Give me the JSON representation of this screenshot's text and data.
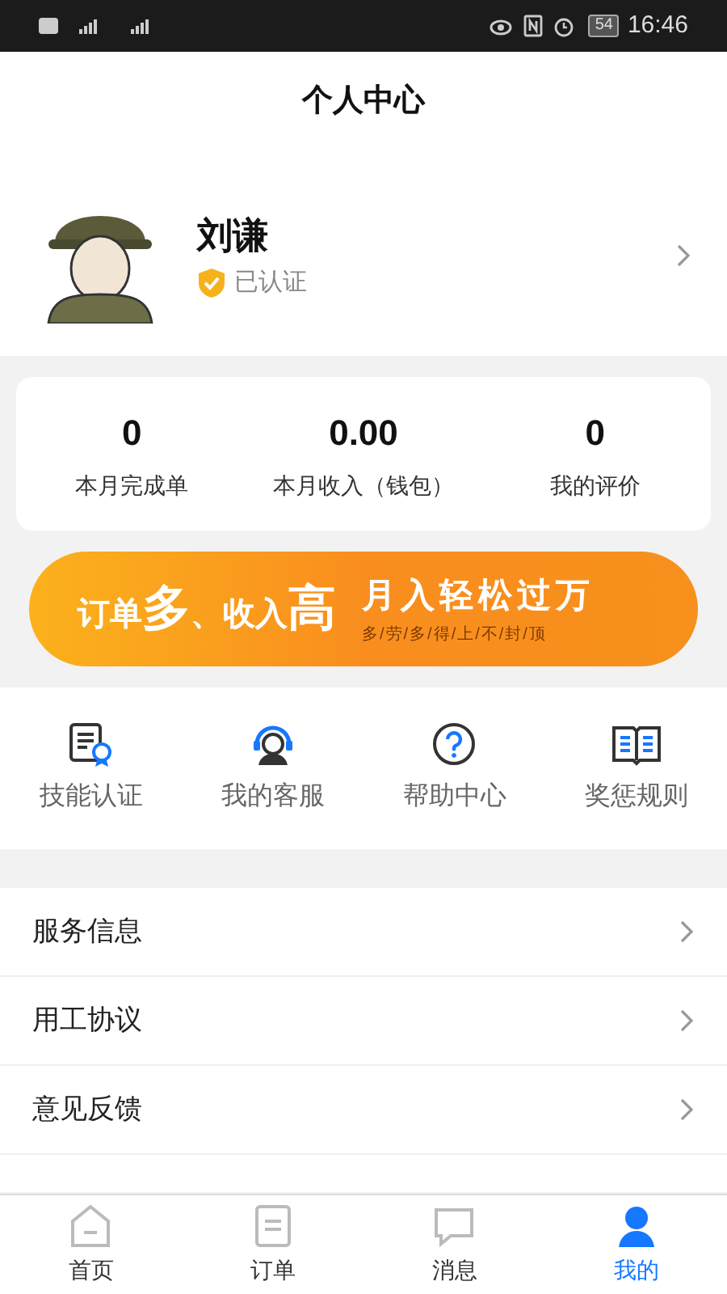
{
  "status_bar": {
    "time": "16:46",
    "battery": "54"
  },
  "header": {
    "title": "个人中心"
  },
  "profile": {
    "name": "刘谦",
    "badge": "已认证"
  },
  "stats": [
    {
      "value": "0",
      "label": "本月完成单"
    },
    {
      "value": "0.00",
      "label": "本月收入（钱包）"
    },
    {
      "value": "0",
      "label": "我的评价"
    }
  ],
  "banner": {
    "headline_parts": [
      "订单",
      "多",
      "、收入",
      "高"
    ],
    "slogan": "月入轻松过万",
    "subline": "多/劳/多/得/上/不/封/顶"
  },
  "shortcuts": [
    {
      "kind": "certificate",
      "label": "技能认证"
    },
    {
      "kind": "support",
      "label": "我的客服"
    },
    {
      "kind": "help",
      "label": "帮助中心"
    },
    {
      "kind": "rules",
      "label": "奖惩规则"
    }
  ],
  "menu": [
    {
      "label": "服务信息"
    },
    {
      "label": "用工协议"
    },
    {
      "label": "意见反馈"
    }
  ],
  "tab_bar": [
    {
      "kind": "home",
      "label": "首页",
      "selected": false
    },
    {
      "kind": "orders",
      "label": "订单",
      "selected": false
    },
    {
      "kind": "messages",
      "label": "消息",
      "selected": false
    },
    {
      "kind": "me",
      "label": "我的",
      "selected": true
    }
  ]
}
